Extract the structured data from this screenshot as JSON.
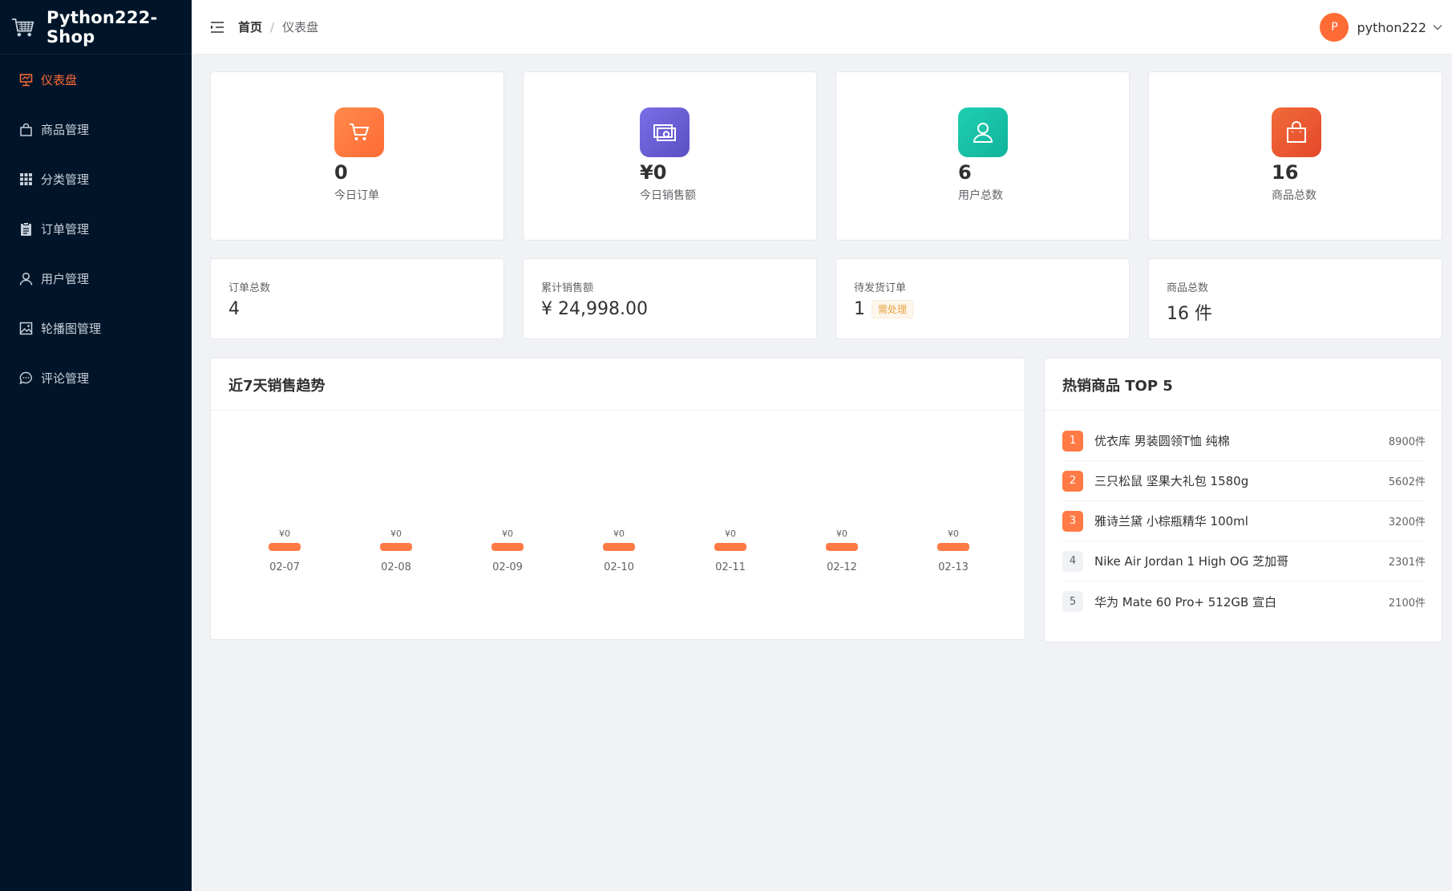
{
  "app": {
    "title": "Python222-Shop"
  },
  "sidebar": {
    "items": [
      {
        "label": "仪表盘",
        "icon": "dashboard-icon",
        "active": true
      },
      {
        "label": "商品管理",
        "icon": "shopping-bag-icon",
        "active": false
      },
      {
        "label": "分类管理",
        "icon": "grid-icon",
        "active": false
      },
      {
        "label": "订单管理",
        "icon": "clipboard-icon",
        "active": false
      },
      {
        "label": "用户管理",
        "icon": "user-icon",
        "active": false
      },
      {
        "label": "轮播图管理",
        "icon": "image-icon",
        "active": false
      },
      {
        "label": "评论管理",
        "icon": "chat-icon",
        "active": false
      }
    ]
  },
  "header": {
    "breadcrumb": {
      "home": "首页",
      "separator": "/",
      "current": "仪表盘"
    },
    "user": {
      "avatar_letter": "P",
      "name": "python222"
    }
  },
  "stats": [
    {
      "value": "0",
      "label": "今日订单",
      "icon": "cart-icon",
      "color": "#ff7a45"
    },
    {
      "value": "¥0",
      "label": "今日销售额",
      "icon": "money-icon",
      "color": "#6b5fd3"
    },
    {
      "value": "6",
      "label": "用户总数",
      "icon": "user-icon",
      "color": "#17c2a6"
    },
    {
      "value": "16",
      "label": "商品总数",
      "icon": "shopping-bag-icon",
      "color": "#ee5b30"
    }
  ],
  "summary": [
    {
      "label": "订单总数",
      "value": "4"
    },
    {
      "label": "累计销售额",
      "value": "¥ 24,998.00"
    },
    {
      "label": "待发货订单",
      "value": "1",
      "badge": "需处理"
    },
    {
      "label": "商品总数",
      "value": "16 件"
    }
  ],
  "sales_chart": {
    "title": "近7天销售趋势",
    "chart_data": {
      "type": "bar",
      "categories": [
        "02-07",
        "02-08",
        "02-09",
        "02-10",
        "02-11",
        "02-12",
        "02-13"
      ],
      "values": [
        0,
        0,
        0,
        0,
        0,
        0,
        0
      ],
      "labels": [
        "¥0",
        "¥0",
        "¥0",
        "¥0",
        "¥0",
        "¥0",
        "¥0"
      ],
      "bar_color": "#ff7a45"
    }
  },
  "top_products": {
    "title": "热销商品 TOP 5",
    "items": [
      {
        "rank": "1",
        "name": "优衣库 男装圆领T恤 纯棉",
        "count": "8900件"
      },
      {
        "rank": "2",
        "name": "三只松鼠 坚果大礼包 1580g",
        "count": "5602件"
      },
      {
        "rank": "3",
        "name": "雅诗兰黛 小棕瓶精华 100ml",
        "count": "3200件"
      },
      {
        "rank": "4",
        "name": "Nike Air Jordan 1 High OG 芝加哥",
        "count": "2301件"
      },
      {
        "rank": "5",
        "name": "华为 Mate 60 Pro+ 512GB 宣白",
        "count": "2100件"
      }
    ]
  }
}
